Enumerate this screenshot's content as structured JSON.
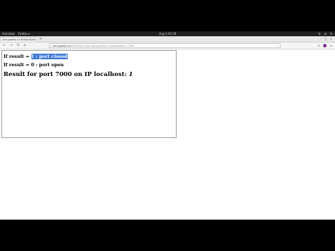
{
  "topbar": {
    "activities": "Activities",
    "app_menu": "Firefox ▾",
    "clock": "Aug 5 05:39",
    "tray_icons": [
      "network-icon",
      "volume-icon",
      "power-icon"
    ]
  },
  "browser": {
    "tab_title": "locs.gstatic.cn 8000/rb/int...",
    "new_tab": "+",
    "url_host": "locs.gstatic.cn",
    "url_path": "/8000/rb/int-tips-doing/profile-sus/adoptable?=7000"
  },
  "page": {
    "line1_prefix": "If result = ",
    "line1_highlight": "1 : port closed",
    "line2": "If result = 0 : port open",
    "line3_prefix": "Result for port 7000 on IP localhost: ",
    "line3_value": "1"
  },
  "colors": {
    "selection": "#3b78d8",
    "extension_avatar": "#7a2d8f"
  }
}
